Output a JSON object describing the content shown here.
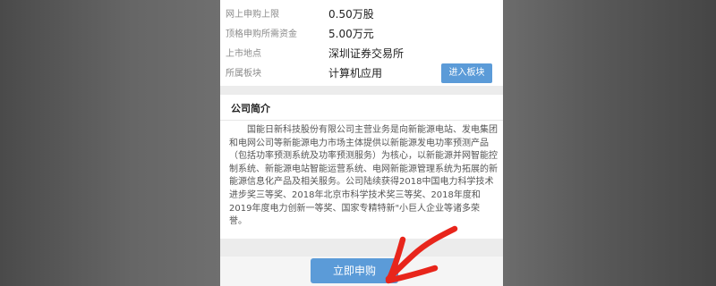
{
  "info": [
    {
      "label": "网上申购上限",
      "value": "0.50万股"
    },
    {
      "label": "顶格申购所需资金",
      "value": "5.00万元"
    },
    {
      "label": "上市地点",
      "value": "深圳证券交易所"
    },
    {
      "label": "所属板块",
      "value": "计算机应用"
    }
  ],
  "enter_sector_button": "进入板块",
  "company_intro": {
    "title": "公司简介",
    "text": "国能日新科技股份有限公司主营业务是向新能源电站、发电集团和电网公司等新能源电力市场主体提供以新能源发电功率预测产品（包括功率预测系统及功率预测服务）为核心，以新能源并网智能控制系统、新能源电站智能运营系统、电网新能源管理系统为拓展的新能源信息化产品及相关服务。公司陆续获得2018中国电力科学技术进步奖三等奖、2018年北京市科学技术奖三等奖、2018年度和2019年度电力创新一等奖、国家专精特新\"小巨人企业等诸多荣誉。"
  },
  "apply_button": "立即申购",
  "colors": {
    "accent": "#5b9bd8",
    "arrow": "#e8251b"
  },
  "annotation_icon": "red-arrow-icon"
}
